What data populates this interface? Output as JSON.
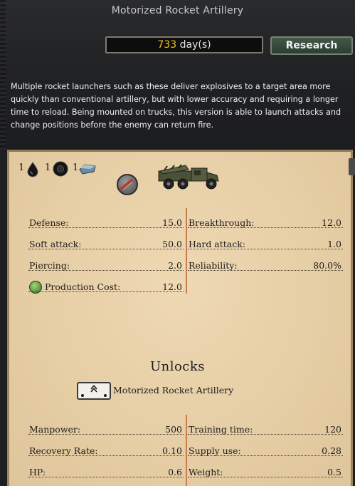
{
  "window": {
    "title": "Motorized Rocket Artillery"
  },
  "research": {
    "days_value": "733",
    "days_unit": "day(s)",
    "button_label": "Research"
  },
  "description": "Multiple rocket launchers such as these deliver explosives to a target area more quickly than conventional artillery, but with lower accuracy and requiring a longer time to reload. Being mounted on trucks, this version is able to launch attacks and change positions before the enemy can return fire.",
  "resources": [
    {
      "count": "1",
      "icon": "oil-drop-icon"
    },
    {
      "count": "1",
      "icon": "rubber-tire-icon"
    },
    {
      "count": "1",
      "icon": "steel-ingot-icon"
    }
  ],
  "stats": {
    "defense": {
      "label": "Defense:",
      "value": "15.0"
    },
    "breakthrough": {
      "label": "Breakthrough:",
      "value": "12.0"
    },
    "soft_attack": {
      "label": "Soft attack:",
      "value": "50.0"
    },
    "hard_attack": {
      "label": "Hard attack:",
      "value": "1.0"
    },
    "piercing": {
      "label": "Piercing:",
      "value": "2.0"
    },
    "reliability": {
      "label": "Reliability:",
      "value": "80.0%"
    },
    "production_cost": {
      "label": "Production Cost:",
      "value": "12.0"
    }
  },
  "unlocks": {
    "title": "Unlocks",
    "unit_name": "Motorized Rocket Artillery",
    "stats": {
      "manpower": {
        "label": "Manpower:",
        "value": "500"
      },
      "training_time": {
        "label": "Training time:",
        "value": "120"
      },
      "recovery_rate": {
        "label": "Recovery Rate:",
        "value": "0.10"
      },
      "supply_use": {
        "label": "Supply use:",
        "value": "0.28"
      },
      "hp": {
        "label": "HP:",
        "value": "0.6"
      },
      "weight": {
        "label": "Weight:",
        "value": "0.5"
      }
    }
  },
  "colors": {
    "days_accent": "#f2c21b",
    "research_button": "#3a4d3f",
    "parchment": "#e9d1a8",
    "divider": "#c77d4f"
  }
}
